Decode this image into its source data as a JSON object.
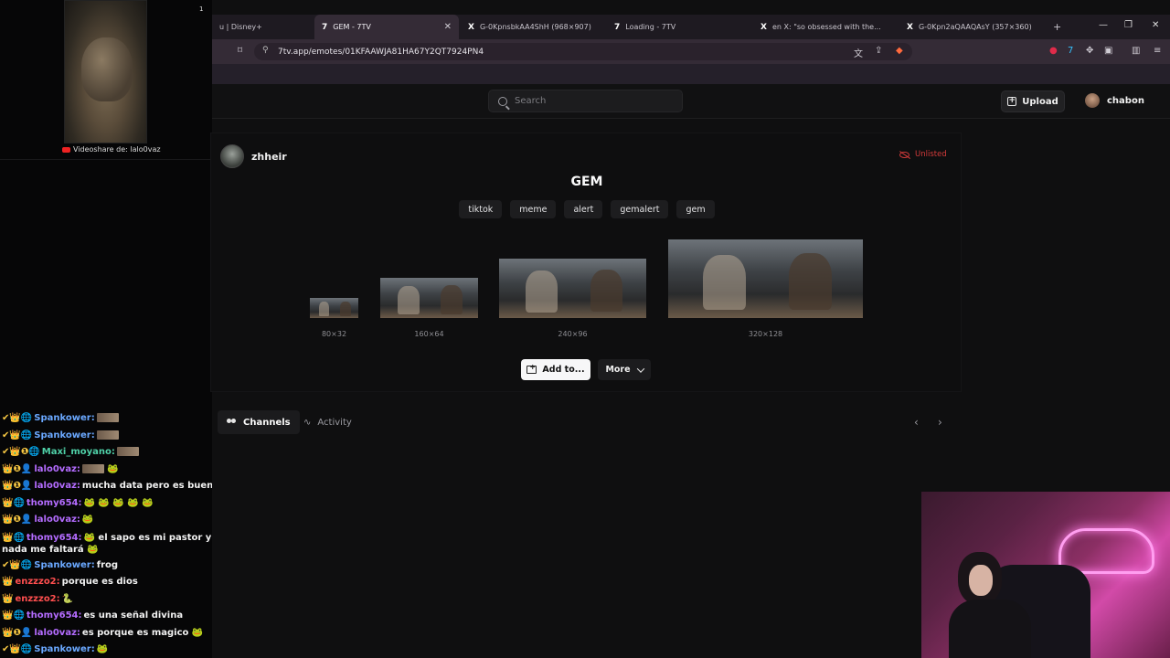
{
  "stream_overlay": {
    "share_label": "Videoshare de: lalo0vaz",
    "corner_mark": "1"
  },
  "chat": {
    "lines": [
      {
        "badges": "✔👑🌐",
        "user": "Spankower:",
        "user_color": "#6aa8ff",
        "msg": ""
      },
      {
        "badges": "✔👑🌐",
        "user": "Spankower:",
        "user_color": "#6aa8ff",
        "msg": ""
      },
      {
        "badges": "✔👑❶🌐",
        "user": "Maxi_moyano:",
        "user_color": "#4fd1a8",
        "msg": ""
      },
      {
        "badges": "👑❶👤",
        "user": "lalo0vaz:",
        "user_color": "#b46cff",
        "msg": "🐸"
      },
      {
        "badges": "👑❶👤",
        "user": "lalo0vaz:",
        "user_color": "#b46cff",
        "msg": "mucha data pero es buen concepto 🐸"
      },
      {
        "badges": "👑🌐",
        "user": "thomy654:",
        "user_color": "#b46cff",
        "msg": "🐸 🐸 🐸 🐸 🐸"
      },
      {
        "badges": "👑❶👤",
        "user": "lalo0vaz:",
        "user_color": "#b46cff",
        "msg": "🐸"
      },
      {
        "badges": "👑🌐",
        "user": "thomy654:",
        "user_color": "#b46cff",
        "msg": "🐸 el sapo es mi pastor y nada me faltará 🐸",
        "wrap": true
      },
      {
        "badges": "✔👑🌐",
        "user": "Spankower:",
        "user_color": "#6aa8ff",
        "msg": "frog"
      },
      {
        "badges": "👑",
        "user": "enzzzo2:",
        "user_color": "#ff4f4f",
        "msg": "porque es dios"
      },
      {
        "badges": "👑",
        "user": "enzzzo2:",
        "user_color": "#ff4f4f",
        "msg": "🐍"
      },
      {
        "badges": "👑🌐",
        "user": "thomy654:",
        "user_color": "#b46cff",
        "msg": "es una señal divina"
      },
      {
        "badges": "👑❶👤",
        "user": "lalo0vaz:",
        "user_color": "#b46cff",
        "msg": "es porque es magico 🐸"
      },
      {
        "badges": "✔👑🌐",
        "user": "Spankower:",
        "user_color": "#6aa8ff",
        "msg": "🐸"
      }
    ]
  },
  "browser": {
    "tabs": [
      {
        "label": "u | Disney+",
        "icon": ""
      },
      {
        "label": "GEM - 7TV",
        "icon": "7",
        "active": true
      },
      {
        "label": "G-0KpnsbkAA4ShH (968×907)",
        "icon": "X"
      },
      {
        "label": "Loading - 7TV",
        "icon": "7"
      },
      {
        "label": "en X: \"so obsessed with the...",
        "icon": "X"
      },
      {
        "label": "G-0Kpn2aQAAQAsY (357×360)",
        "icon": "X"
      }
    ],
    "url": "7tv.app/emotes/01KFAAWJA81HA67Y2QT7924PN4",
    "new_tab": "+"
  },
  "site": {
    "search_placeholder": "Search",
    "upload_label": "Upload",
    "username": "chabon"
  },
  "emote": {
    "owner": "zhheir",
    "visibility": "Unlisted",
    "title": "GEM",
    "tags": [
      "tiktok",
      "meme",
      "alert",
      "gemalert",
      "gem"
    ],
    "sizes": [
      "80×32",
      "160×64",
      "240×96",
      "320×128"
    ],
    "add_label": "Add to...",
    "more_label": "More"
  },
  "subtabs": {
    "channels": "Channels",
    "activity": "Activity"
  }
}
